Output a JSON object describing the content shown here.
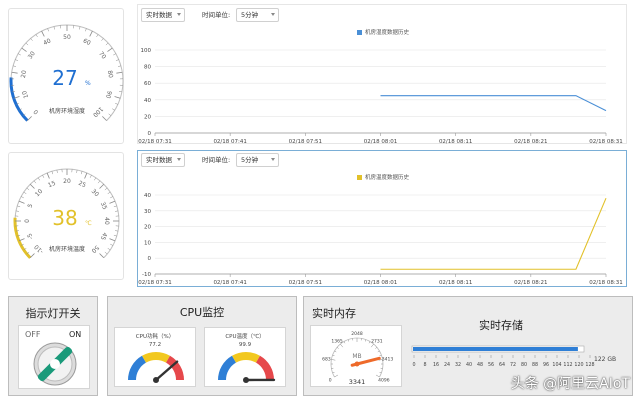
{
  "gauges": [
    {
      "value": "27",
      "unit": "%",
      "label": "机房环境湿度",
      "ticks": [
        "0",
        "10",
        "20",
        "30",
        "40",
        "50",
        "60",
        "70",
        "80",
        "90",
        "100"
      ],
      "color": "#1f6fd1"
    },
    {
      "value": "38",
      "unit": "℃",
      "label": "机房环境温度",
      "ticks": [
        "-10",
        "-5",
        "0",
        "5",
        "10",
        "15",
        "20",
        "25",
        "30",
        "35",
        "40",
        "45",
        "50"
      ],
      "color": "#e2c12a"
    }
  ],
  "charts": [
    {
      "mode": "实时数据",
      "unit_label": "时间单位:",
      "unit": "5分钟",
      "legend": "机房湿度数据历史",
      "color": "#4a8fd6",
      "chart_data": {
        "type": "line",
        "x": [
          "02/18 07:31",
          "02/18 07:41",
          "02/18 07:51",
          "02/18 08:01",
          "02/18 08:11",
          "02/18 08:21",
          "02/18 08:31"
        ],
        "y_ticks": [
          "0",
          "20",
          "40",
          "60",
          "80",
          "100"
        ],
        "ylim": [
          0,
          100
        ],
        "series": [
          {
            "points": [
              [
                3.0,
                45
              ],
              [
                5.6,
                45
              ],
              [
                6.0,
                27
              ]
            ]
          }
        ]
      }
    },
    {
      "mode": "实时数据",
      "unit_label": "时间单位:",
      "unit": "5分钟",
      "legend": "机房温度数据历史",
      "color": "#e2c12a",
      "chart_data": {
        "type": "line",
        "x": [
          "02/18 07:31",
          "02/18 07:41",
          "02/18 07:51",
          "02/18 08:01",
          "02/18 08:11",
          "02/18 08:21",
          "02/18 08:31"
        ],
        "y_ticks": [
          "-10",
          "0",
          "10",
          "20",
          "30",
          "40"
        ],
        "ylim": [
          -10,
          40
        ],
        "series": [
          {
            "points": [
              [
                3.0,
                -7
              ],
              [
                5.6,
                -7
              ],
              [
                6.0,
                38
              ]
            ]
          }
        ]
      }
    }
  ],
  "light": {
    "title": "指示灯开关",
    "off": "OFF",
    "on": "ON"
  },
  "cpu": {
    "title": "CPU监控",
    "usage": {
      "title": "CPU功耗（%）",
      "value": "77.2",
      "fraction": 0.772
    },
    "temp": {
      "title": "CPU温度（℃）",
      "value": "99.9",
      "fraction": 0.999
    }
  },
  "memory": {
    "title": "实时内存",
    "unit": "MB",
    "value": "3341",
    "fraction": 0.815,
    "ticks": [
      "0",
      "683",
      "1365",
      "2048",
      "2731",
      "3413",
      "4096"
    ]
  },
  "storage": {
    "title": "实时存储",
    "unit": "122 GB",
    "fraction": 0.97,
    "ticks": [
      "0",
      "8",
      "16",
      "24",
      "32",
      "40",
      "48",
      "56",
      "64",
      "72",
      "80",
      "88",
      "96",
      "104",
      "112",
      "120",
      "128"
    ]
  },
  "watermark": "头条 @阿里云AIoT"
}
